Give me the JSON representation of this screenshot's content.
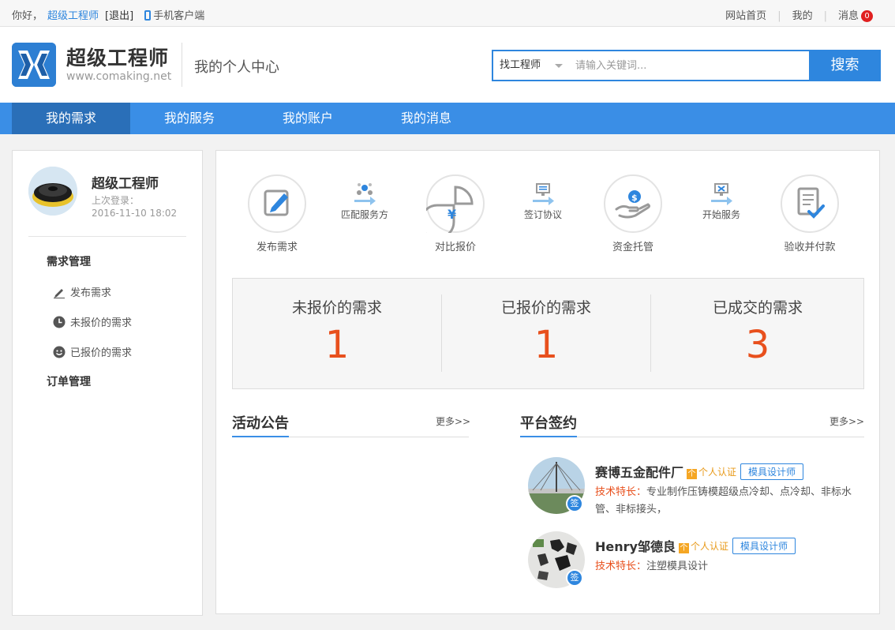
{
  "topbar": {
    "greeting": "你好，",
    "username": "超级工程师",
    "logout": "[退出]",
    "mobile_client": "手机客户端",
    "links": [
      "网站首页",
      "我的",
      "消息"
    ],
    "message_count": "0"
  },
  "header": {
    "brand_name": "超级工程师",
    "brand_url": "www.comaking.net",
    "center_title": "我的个人中心",
    "search": {
      "category": "找工程师",
      "placeholder": "请输入关键词...",
      "button": "搜索"
    }
  },
  "nav": {
    "items": [
      "我的需求",
      "我的服务",
      "我的账户",
      "我的消息"
    ],
    "active_index": 0
  },
  "sidebar": {
    "profile": {
      "name": "超级工程师",
      "last_login_label": "上次登录：",
      "last_login_time": "2016-11-10 18:02"
    },
    "groups": [
      {
        "title": "需求管理",
        "items": [
          {
            "label": "发布需求",
            "icon": "pencil-icon"
          },
          {
            "label": "未报价的需求",
            "icon": "clock-icon"
          },
          {
            "label": "已报价的需求",
            "icon": "smile-icon"
          }
        ]
      },
      {
        "title": "订单管理",
        "items": []
      }
    ]
  },
  "process": {
    "steps": [
      {
        "label": "发布需求",
        "icon": "edit-icon"
      },
      {
        "label": "对比报价",
        "icon": "yen-chart-icon"
      },
      {
        "label": "资金托管",
        "icon": "money-hand-icon"
      },
      {
        "label": "验收并付款",
        "icon": "check-document-icon"
      }
    ],
    "transitions": [
      {
        "label": "匹配服务方",
        "icon": "network-icon"
      },
      {
        "label": "签订协议",
        "icon": "monitor-icon"
      },
      {
        "label": "开始服务",
        "icon": "tools-icon"
      }
    ]
  },
  "stats": [
    {
      "label": "未报价的需求",
      "value": "1"
    },
    {
      "label": "已报价的需求",
      "value": "1"
    },
    {
      "label": "已成交的需求",
      "value": "3"
    }
  ],
  "announcements": {
    "title": "活动公告",
    "more": "更多>>"
  },
  "signings": {
    "title": "平台签约",
    "more": "更多>>",
    "badge": "签",
    "cert_label": "个人认证",
    "cert_icon_char": "个",
    "specialty_label": "技术特长：",
    "items": [
      {
        "name": "赛博五金配件厂",
        "role": "模具设计师",
        "specialty": "专业制作压铸模超级点冷却、点冷却、非标水管、非标接头，"
      },
      {
        "name": "Henry邹德良",
        "role": "模具设计师",
        "specialty": "注塑模具设计"
      }
    ]
  },
  "colors": {
    "primary": "#3a8ee6",
    "nav_active": "#2a6fb8",
    "accent_orange": "#e8501d",
    "badge_red": "#e02020"
  }
}
